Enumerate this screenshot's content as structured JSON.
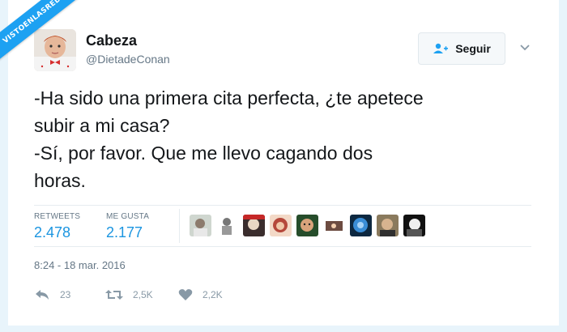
{
  "watermark": "VISTOENLASREDES",
  "author": {
    "name": "Cabeza",
    "handle": "@DietadeConan"
  },
  "follow_button": {
    "label": "Seguir",
    "icon": "person-add-icon"
  },
  "tweet": {
    "lines": [
      "-Ha sido una primera cita perfecta, ¿te apetece",
      "subir a mi casa?",
      "-Sí, por favor. Que me llevo cagando dos",
      "horas."
    ]
  },
  "stats": {
    "retweets_label": "RETWEETS",
    "retweets_value": "2.478",
    "likes_label": "ME GUSTA",
    "likes_value": "2.177"
  },
  "timestamp": "8:24 - 18 mar. 2016",
  "actions": {
    "reply_count": "23",
    "retweet_count": "2,5K",
    "like_count": "2,2K"
  },
  "colors": {
    "accent": "#1b95e0",
    "muted": "#657786",
    "text": "#14171a",
    "watermark_bg": "#1da1f2"
  }
}
